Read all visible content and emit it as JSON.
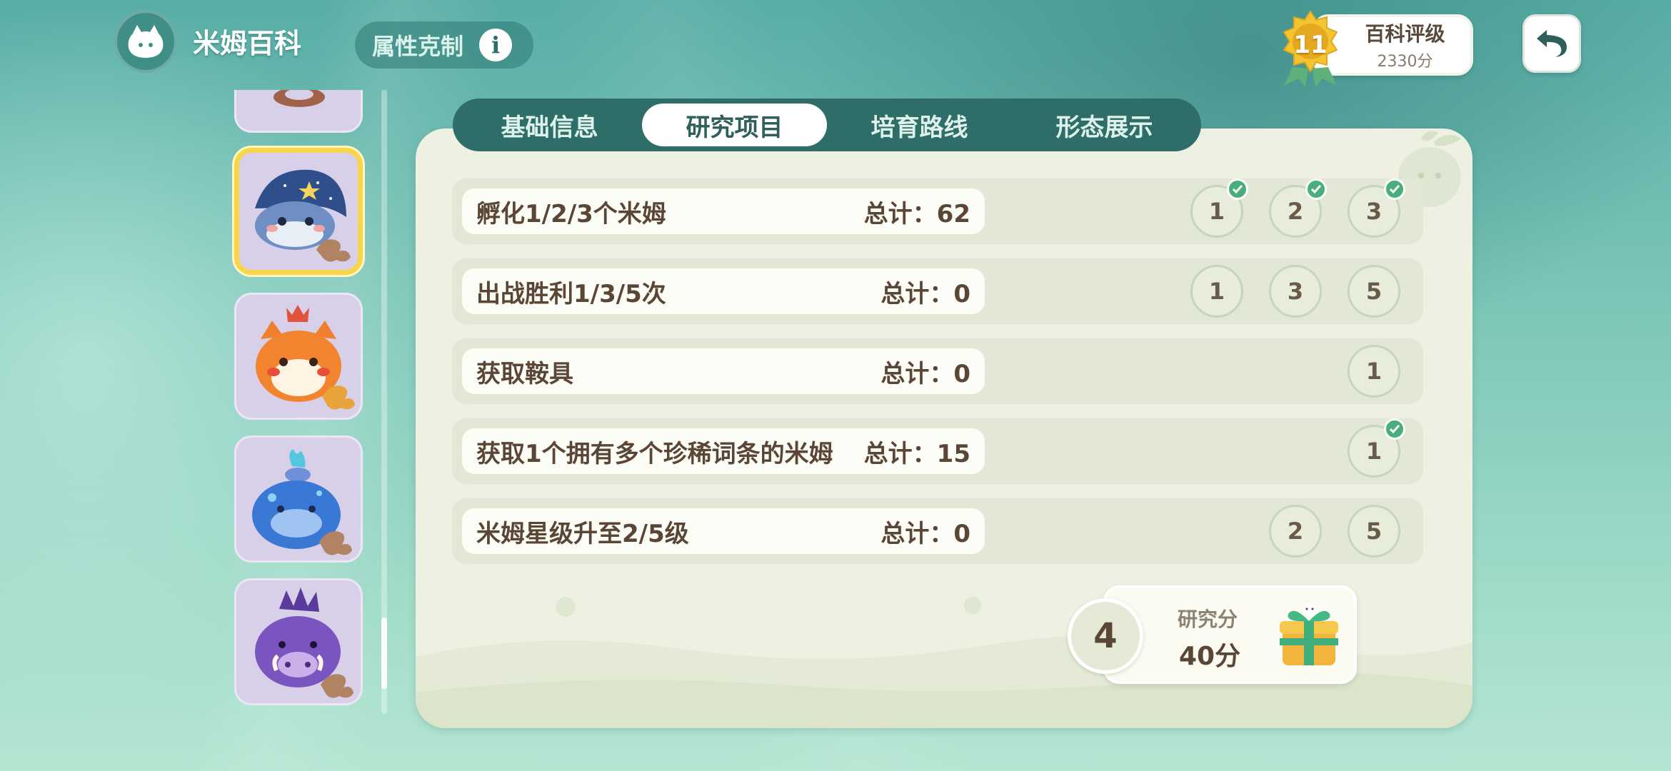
{
  "header": {
    "app_title": "米姆百科",
    "attr_button_label": "属性克制",
    "info_icon_glyph": "i"
  },
  "rating": {
    "level": "11",
    "label": "百科评级",
    "score": "2330分"
  },
  "tabs": [
    {
      "label": "基础信息",
      "active": false
    },
    {
      "label": "研究项目",
      "active": true
    },
    {
      "label": "培育路线",
      "active": false
    },
    {
      "label": "形态展示",
      "active": false
    }
  ],
  "research_rows": [
    {
      "task": "孵化1/2/3个米姆",
      "total": "总计：62",
      "milestones": [
        {
          "value": "1",
          "done": true
        },
        {
          "value": "2",
          "done": true
        },
        {
          "value": "3",
          "done": true
        }
      ]
    },
    {
      "task": "出战胜利1/3/5次",
      "total": "总计：0",
      "milestones": [
        {
          "value": "1",
          "done": false
        },
        {
          "value": "3",
          "done": false
        },
        {
          "value": "5",
          "done": false
        }
      ]
    },
    {
      "task": "获取鞍具",
      "total": "总计：0",
      "milestones": [
        {
          "value": "1",
          "done": false
        }
      ]
    },
    {
      "task": "获取1个拥有多个珍稀词条的米姆",
      "total": "总计：15",
      "milestones": [
        {
          "value": "1",
          "done": true
        }
      ]
    },
    {
      "task": "米姆星级升至2/5级",
      "total": "总计：0",
      "milestones": [
        {
          "value": "2",
          "done": false
        },
        {
          "value": "5",
          "done": false
        }
      ]
    }
  ],
  "research_score": {
    "level": "4",
    "label": "研究分",
    "value": "40分"
  },
  "creature_list": [
    {
      "name": "creature-card-partial",
      "selected": false
    },
    {
      "name": "creature-card-star-whale",
      "selected": true
    },
    {
      "name": "creature-card-fire-fox",
      "selected": false
    },
    {
      "name": "creature-card-water-blob",
      "selected": false
    },
    {
      "name": "creature-card-purple-boar",
      "selected": false
    }
  ],
  "colors": {
    "tab_bar": "#2e6d68",
    "panel": "#eef1e2",
    "selected_border": "#f7d64a",
    "check_green": "#4aae7c",
    "text_brown": "#5b4636"
  }
}
